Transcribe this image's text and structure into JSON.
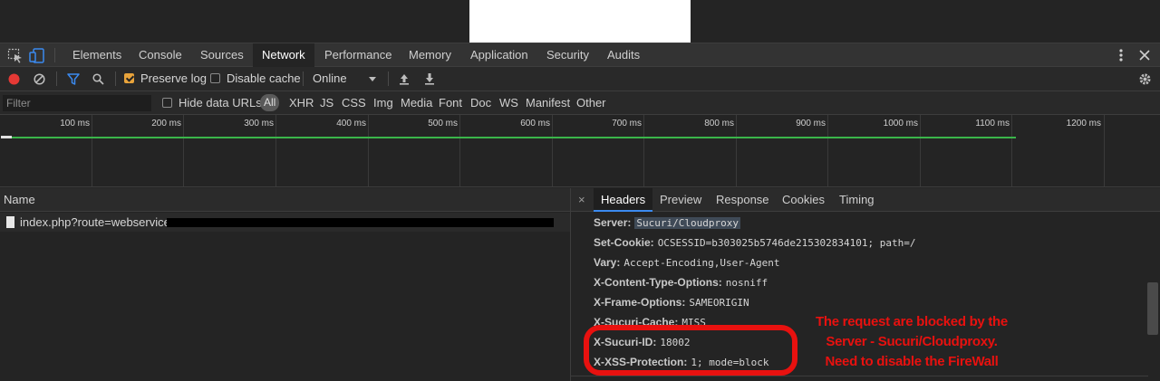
{
  "main_tabs": [
    "Elements",
    "Console",
    "Sources",
    "Network",
    "Performance",
    "Memory",
    "Application",
    "Security",
    "Audits"
  ],
  "active_main_tab": "Network",
  "toolbar": {
    "preserve_log_label": "Preserve log",
    "preserve_log_checked": true,
    "disable_cache_label": "Disable cache",
    "disable_cache_checked": false,
    "throttle_value": "Online"
  },
  "filter": {
    "placeholder": "Filter",
    "hide_data_urls_label": "Hide data URLs",
    "types": [
      "All",
      "XHR",
      "JS",
      "CSS",
      "Img",
      "Media",
      "Font",
      "Doc",
      "WS",
      "Manifest",
      "Other"
    ]
  },
  "timeline": {
    "ticks": [
      "100 ms",
      "200 ms",
      "300 ms",
      "400 ms",
      "500 ms",
      "600 ms",
      "700 ms",
      "800 ms",
      "900 ms",
      "1000 ms",
      "1100 ms",
      "1200 ms"
    ]
  },
  "request_list": {
    "column_name": "Name",
    "rows": [
      {
        "name": "index.php?route=webservices"
      }
    ]
  },
  "detail": {
    "tabs": [
      "Headers",
      "Preview",
      "Response",
      "Cookies",
      "Timing"
    ],
    "active_tab": "Headers",
    "close_glyph": "×",
    "headers": [
      {
        "name": "Server:",
        "value": "Sucuri/Cloudproxy"
      },
      {
        "name": "Set-Cookie:",
        "value": "OCSESSID=b303025b5746de215302834101; path=/"
      },
      {
        "name": "Vary:",
        "value": "Accept-Encoding,User-Agent"
      },
      {
        "name": "X-Content-Type-Options:",
        "value": "nosniff"
      },
      {
        "name": "X-Frame-Options:",
        "value": "SAMEORIGIN"
      },
      {
        "name": "X-Sucuri-Cache:",
        "value": "MISS"
      },
      {
        "name": "X-Sucuri-ID:",
        "value": "18002"
      },
      {
        "name": "X-XSS-Protection:",
        "value": "1; mode=block"
      }
    ]
  },
  "annotation": {
    "lines": [
      "The request are blocked by the",
      "Server - Sucuri/Cloudproxy.",
      "Need to disable the FireWall"
    ],
    "color": "#e8110f"
  },
  "colors": {
    "accent_blue": "#3b8af0",
    "record_red": "#e53935",
    "checkbox_orange": "#e8a33b",
    "timeline_green": "#3ab54a"
  }
}
